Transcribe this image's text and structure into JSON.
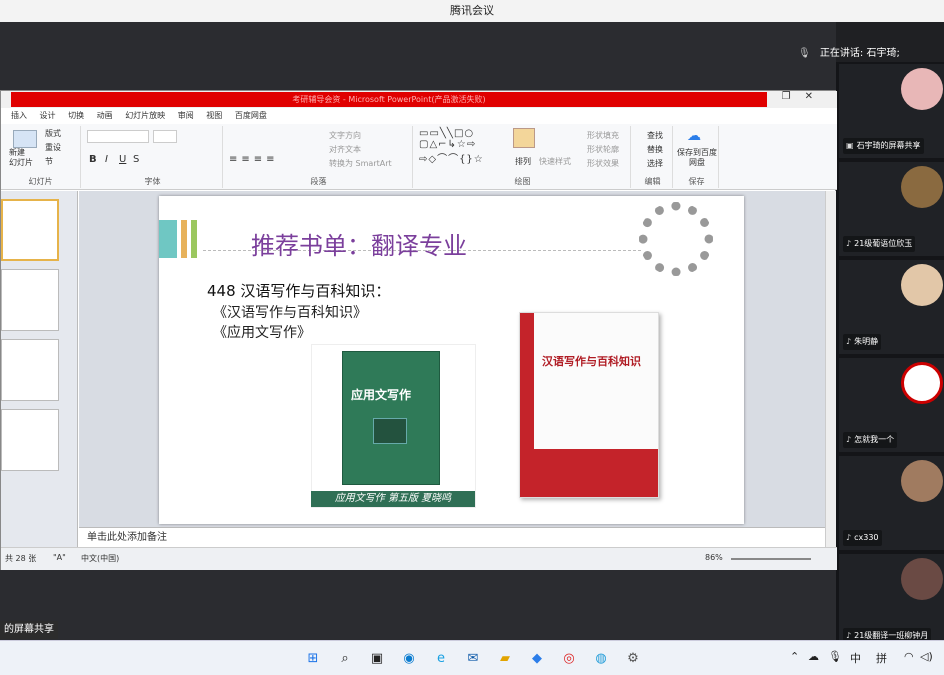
{
  "app_title": "腾讯会议",
  "speaking_label": "正在讲话: 石宇琦;",
  "participants": [
    {
      "name": "石宇琦的屏幕共享",
      "color": "#e8b7b7"
    },
    {
      "name": "21级葡语位欣玉",
      "color": "#3a2a1c"
    },
    {
      "name": "朱明静",
      "color": "#e2c7a8"
    },
    {
      "name": "怎就我一个",
      "color": "#eeeeee"
    },
    {
      "name": "cx330",
      "color": "#a07b60"
    },
    {
      "name": "21级翻译一班柳钟月",
      "color": "#6a4a44"
    }
  ],
  "ppt": {
    "window_title": "考研辅导会资 - Microsoft PowerPoint(产品激活失败)",
    "tabs": [
      "插入",
      "设计",
      "切换",
      "动画",
      "幻灯片放映",
      "审阅",
      "视图",
      "百度网盘"
    ],
    "groups": {
      "slides": {
        "label": "幻灯片",
        "new_slide": "新建\n幻灯片",
        "layout": "版式",
        "reset": "重设",
        "section": "节"
      },
      "font": {
        "label": "字体"
      },
      "paragraph": {
        "label": "段落",
        "text_dir": "文字方向",
        "align": "对齐文本",
        "smartart": "转换为 SmartArt"
      },
      "drawing": {
        "label": "绘图",
        "arrange": "排列",
        "quick_styles": "快速样式",
        "fill": "形状填充",
        "outline": "形状轮廓",
        "effects": "形状效果"
      },
      "edit": {
        "label": "编辑",
        "find": "查找",
        "replace": "替换",
        "select": "选择"
      },
      "save": {
        "label": "保存",
        "save_baidu": "保存到百度网盘"
      }
    },
    "notes_placeholder": "单击此处添加备注",
    "status": {
      "slides_count": "共 28 张",
      "theme": "\"A\"",
      "language": "中文(中国)",
      "zoom": "86%"
    }
  },
  "slide": {
    "title": "推荐书单：翻译专业",
    "heading": "448 汉语写作与百科知识：",
    "books": [
      "《汉语写作与百科知识》",
      "《应用文写作》"
    ],
    "book1_cover_title": "应用文写作",
    "book1_caption": "应用文写作 第五版  夏晓鸣",
    "book2_cover_title": "汉语写作与百科知识"
  },
  "screenshare_label": "的屏幕共享",
  "tray": {
    "ime": "中",
    "layout": "拼"
  }
}
